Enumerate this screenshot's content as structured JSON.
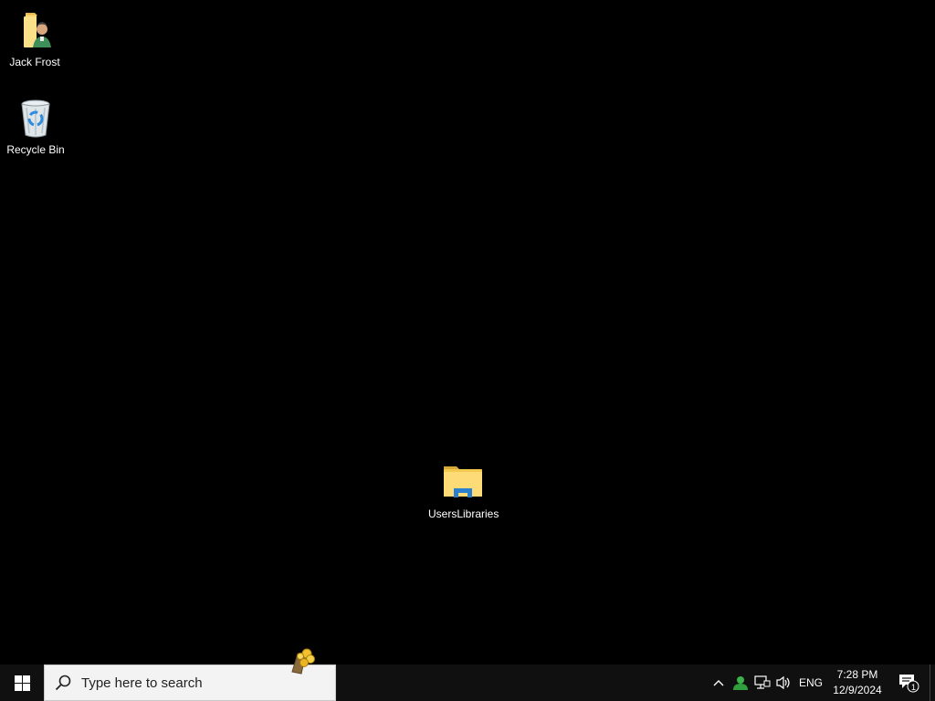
{
  "desktop": {
    "icons": [
      {
        "label": "Jack Frost",
        "icon": "user-folder-icon"
      },
      {
        "label": "Recycle Bin",
        "icon": "recycle-bin-icon"
      },
      {
        "label": "UsersLibraries",
        "icon": "file-explorer-icon"
      }
    ]
  },
  "taskbar": {
    "start_icon": "windows-logo-icon",
    "search": {
      "placeholder": "Type here to search",
      "icon": "search-icon"
    },
    "pinned_app_icon": "gold-coins-app-icon",
    "tray": {
      "chevron_icon": "chevron-up-icon",
      "people_icon": "people-icon",
      "network_icon": "network-icon",
      "volume_icon": "volume-icon",
      "language": "ENG",
      "time": "7:28 PM",
      "date": "12/9/2024",
      "notifications_icon": "action-center-icon",
      "notification_count": "1"
    }
  }
}
